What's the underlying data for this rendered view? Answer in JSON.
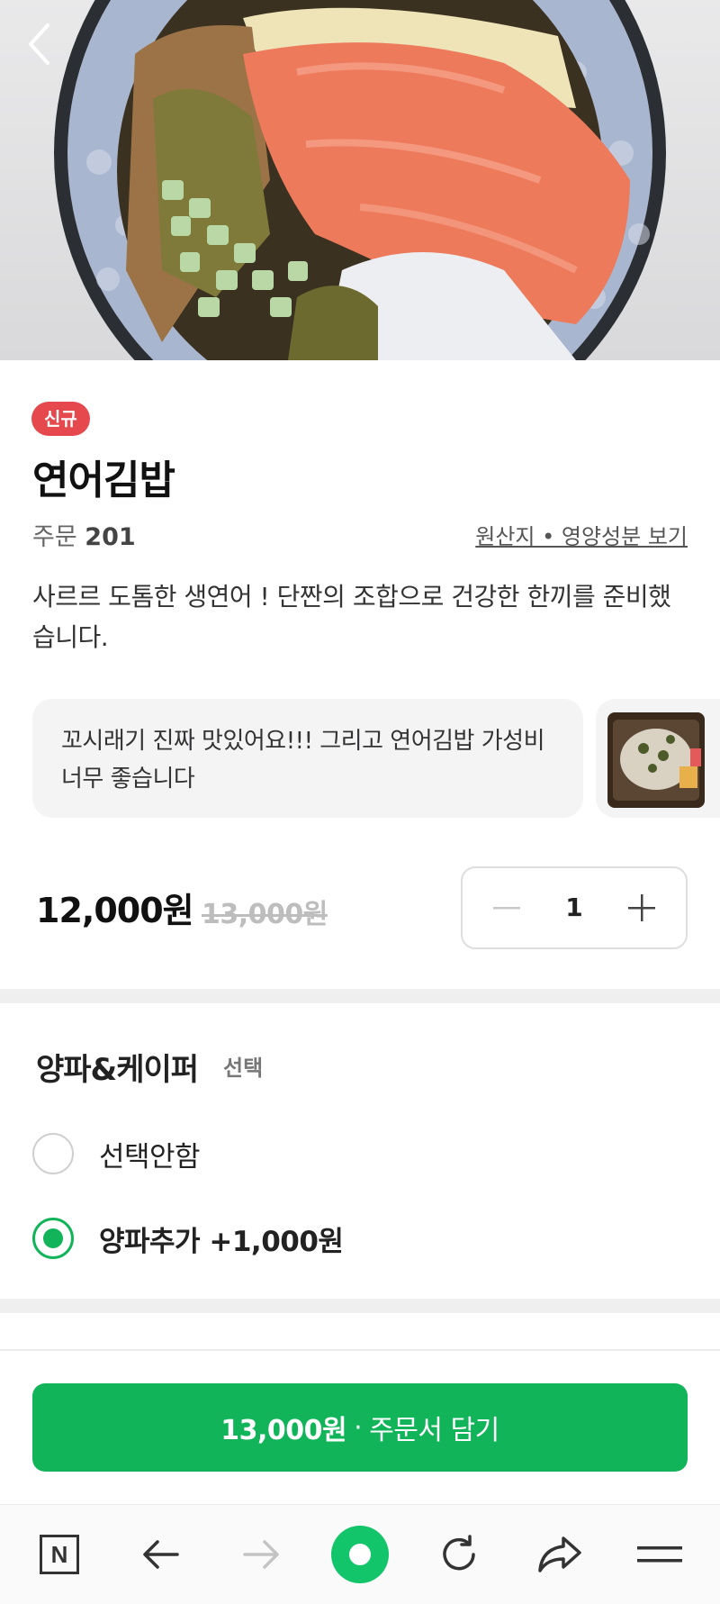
{
  "product": {
    "badge": "신규",
    "name": "연어김밥",
    "order_label": "주문",
    "order_count": "201",
    "origin_link": "원산지 • 영양성분 보기",
    "description": "사르르 도톰한 생연어 ! 단짠의 조합으로 건강한 한끼를 준비했습니다."
  },
  "review": {
    "text": "꼬시래기 진짜 맛있어요!!! 그리고 연어김밥 가성비 너무 좋습니다"
  },
  "pricing": {
    "price": "12,000원",
    "original_price": "13,000원",
    "quantity": "1"
  },
  "option_group": {
    "title": "양파&케이퍼",
    "tag": "선택",
    "options": [
      {
        "label": "선택안함",
        "selected": false
      },
      {
        "label": "양파추가 +1,000원",
        "selected": true
      }
    ]
  },
  "cta": {
    "amount": "13,000원",
    "separator": "·",
    "label": "주문서 담기"
  },
  "browser_bar": {
    "home_letter": "N",
    "icons": [
      "naver-home-icon",
      "back-arrow-icon",
      "forward-arrow-icon",
      "green-dot-icon",
      "refresh-icon",
      "share-icon",
      "menu-icon"
    ]
  },
  "colors": {
    "accent": "#12b45a",
    "badge": "#e5484d"
  }
}
